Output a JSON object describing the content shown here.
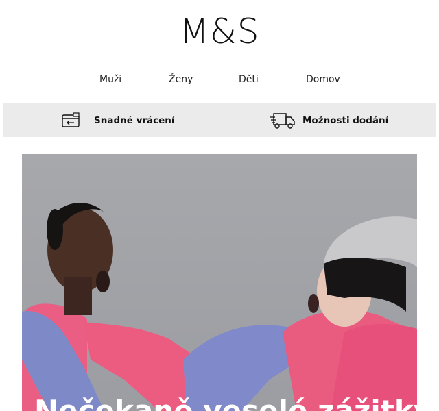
{
  "header": {
    "logo": "M&S"
  },
  "nav": {
    "items": [
      "Muži",
      "Ženy",
      "Děti",
      "Domov"
    ]
  },
  "benefits": {
    "returns_label": "Snadné vrácení",
    "returns_icon": "returns-card-icon",
    "delivery_label": "Možnosti dodání",
    "delivery_icon": "delivery-truck-icon"
  },
  "hero": {
    "title": "Nečekaně veselé zážitky",
    "image_alt": "Two laughing models in pink and blue knit sweaters"
  },
  "colors": {
    "benefit_bar": "#ebebeb",
    "hero_background": "#a4a5a9",
    "pink": "#ea5a7c",
    "blue": "#7c86c6"
  }
}
